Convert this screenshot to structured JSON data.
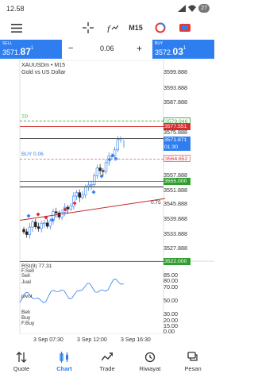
{
  "status_bar": {
    "time": "12.58",
    "battery": "27"
  },
  "toolbar": {
    "timeframe": "M15",
    "items": [
      "crosshair-icon",
      "indicator-icon",
      "timeframe-selector",
      "objects-icon",
      "trade-icon"
    ]
  },
  "trade_panel": {
    "sell": {
      "label": "SELL",
      "price_prefix": "3571.",
      "price_big": "87",
      "price_sup": "1"
    },
    "buy": {
      "label": "BUY",
      "price_prefix": "3572.",
      "price_big": "03",
      "price_sup": "1"
    },
    "lot": "0.06",
    "minus": "−",
    "plus": "+"
  },
  "chart": {
    "symbol": "XAUUSDm • M15",
    "description": "Gold vs US Dollar",
    "price_levels": [
      "3599.888",
      "3593.888",
      "3587.888",
      "3581.888",
      "3575.888",
      "3569.888",
      "3557.888",
      "3551.888",
      "3545.888",
      "3539.888",
      "3533.888",
      "3527.888"
    ],
    "tags": {
      "tp": "3579.946",
      "red": "3577.551",
      "bid": "3571.871",
      "bid_time": "01:30",
      "entry": "3564.652",
      "green": "3555.000",
      "green_low": "3522.000"
    },
    "labels": {
      "tp": "TP",
      "buy_line": "BUY 0.06",
      "trendline_value": "0.75"
    },
    "subwindow": {
      "title": "RSI(9) 77.31",
      "levels": [
        "85.00",
        "80.00",
        "70.00",
        "50.00",
        "30.00",
        "20.00",
        "15.00",
        "0.00"
      ],
      "left_labels": [
        "F.Sell",
        "Sell",
        "Jual",
        "pivot",
        "Beli",
        "Buy",
        "F.Buy"
      ]
    },
    "time_labels": [
      "3 Sep 07:30",
      "3 Sep 12:00",
      "3 Sep 16:30"
    ]
  },
  "nav": [
    {
      "label": "Quote",
      "icon": "quote-icon"
    },
    {
      "label": "Chart",
      "icon": "chart-icon"
    },
    {
      "label": "Trade",
      "icon": "trade-icon"
    },
    {
      "label": "Riwayat",
      "icon": "history-icon"
    },
    {
      "label": "Pesan",
      "icon": "messages-icon"
    }
  ],
  "colors": {
    "accent": "#2f7ef0",
    "bull": "#2f7ef0",
    "bear": "#222222",
    "tp_line": "#4caf50",
    "red_line": "#d32f2f",
    "green_line": "#2e9e2e"
  }
}
